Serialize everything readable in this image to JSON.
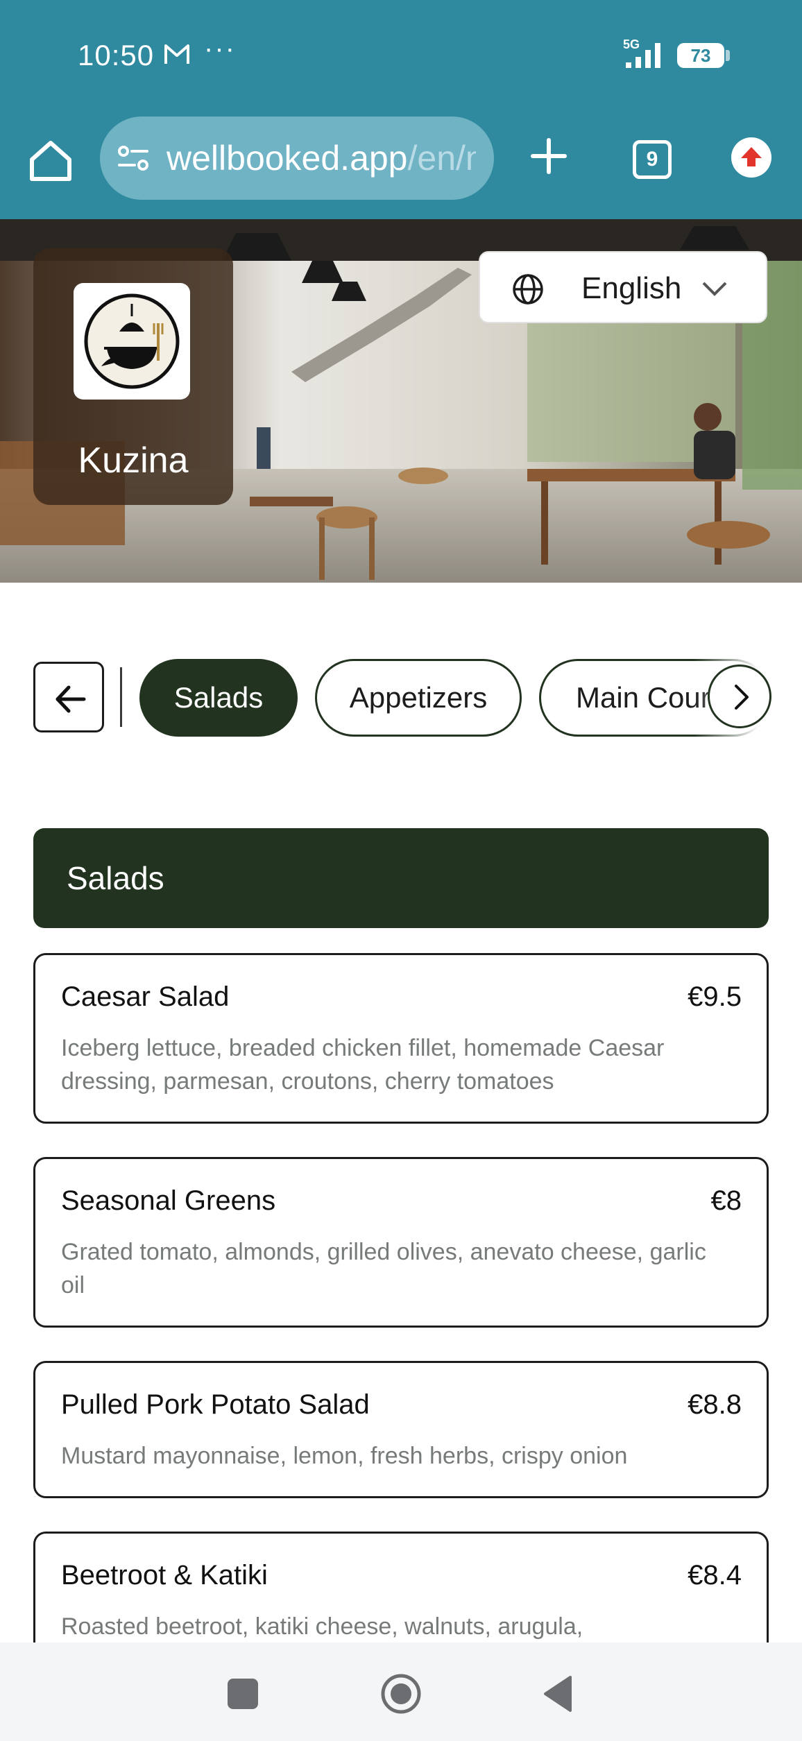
{
  "status_bar": {
    "time": "10:50",
    "more": "···",
    "network": "5G",
    "battery": "73"
  },
  "browser": {
    "url_domain": "wellbooked.app",
    "url_path": "/en/m",
    "tabs_count": "9"
  },
  "hero": {
    "restaurant_name": "Kuzina",
    "language_selected": "English"
  },
  "categories": {
    "items": [
      {
        "label": "Salads",
        "active": true
      },
      {
        "label": "Appetizers",
        "active": false
      },
      {
        "label": "Main Cour",
        "active": false
      }
    ]
  },
  "section": {
    "title": "Salads",
    "items": [
      {
        "name": "Caesar Salad",
        "price": "€9.5",
        "description": "Iceberg lettuce, breaded chicken fillet, homemade Caesar dressing, parmesan, croutons, cherry tomatoes"
      },
      {
        "name": "Seasonal Greens",
        "price": "€8",
        "description": "Grated tomato, almonds, grilled olives, anevato cheese, garlic oil"
      },
      {
        "name": "Pulled Pork Potato Salad",
        "price": "€8.8",
        "description": "Mustard mayonnaise, lemon, fresh herbs, crispy onion"
      },
      {
        "name": "Beetroot & Katiki",
        "price": "€8.4",
        "description": "Roasted beetroot, katiki cheese, walnuts, arugula,"
      }
    ]
  },
  "colors": {
    "browser_chrome": "#2f8aa0",
    "accent_dark_green": "#223320",
    "description_gray": "#777a7a"
  }
}
